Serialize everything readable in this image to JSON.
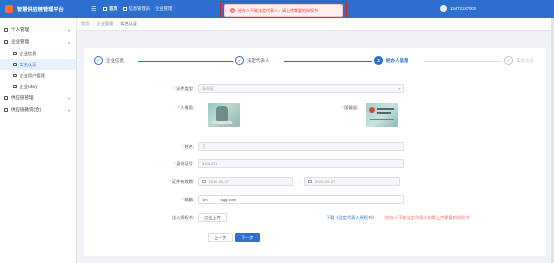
{
  "app": {
    "title": "智慧供应链管理平台"
  },
  "topnav": [
    {
      "label": "首页",
      "active": true
    },
    {
      "label": "信息管理员",
      "active": false
    },
    {
      "label": "企业管理",
      "active": false
    }
  ],
  "user": {
    "phone": "15472187000"
  },
  "alert": {
    "message": "经办人不能法定代表人，请上传需要的授权书"
  },
  "sidebar": {
    "groups": [
      {
        "label": "个人管理",
        "expanded": false,
        "items": []
      },
      {
        "label": "企业管理",
        "expanded": true,
        "items": [
          {
            "label": "企业信息",
            "active": false
          },
          {
            "label": "实名认证",
            "active": true
          },
          {
            "label": "企业用户管理",
            "active": false
          },
          {
            "label": "企业Ukey",
            "active": false
          }
        ]
      },
      {
        "label": "供应链管理",
        "expanded": false,
        "items": []
      },
      {
        "label": "供应链融资(合)",
        "expanded": false,
        "items": []
      }
    ]
  },
  "breadcrumb": {
    "home": "首页",
    "items": [
      "企业管理",
      "实名认证"
    ]
  },
  "steps": [
    {
      "index": "✓",
      "label": "企业信息",
      "state": "done"
    },
    {
      "index": "✓",
      "label": "法定代表人",
      "state": "done"
    },
    {
      "index": "3",
      "label": "经办人信息",
      "state": "active"
    },
    {
      "index": "4",
      "label": "实名认证",
      "state": "pending"
    }
  ],
  "form": {
    "cert_type": {
      "label": "证件类型:",
      "value": "身份证"
    },
    "front": {
      "label": "人像面:"
    },
    "back": {
      "label": "国徽面:"
    },
    "name": {
      "label": "姓名:",
      "value": "王"
    },
    "id_number": {
      "label": "身份证号:",
      "value": "5101271"
    },
    "validity": {
      "label": "证件有效期:",
      "start": "2016-05-27",
      "end": "2026-05-27",
      "separator": "-"
    },
    "email": {
      "label": "邮箱:",
      "value": "1m            sgg.com"
    },
    "auth_letter": {
      "label": "法人授权书:",
      "upload_label": "点击上传",
      "download_label": "下载《法定代表人授权书》",
      "warning": "*经办人不能法定代表人则需上传需要的授权书"
    }
  },
  "actions": {
    "prev": "上一步",
    "next": "下一步"
  }
}
